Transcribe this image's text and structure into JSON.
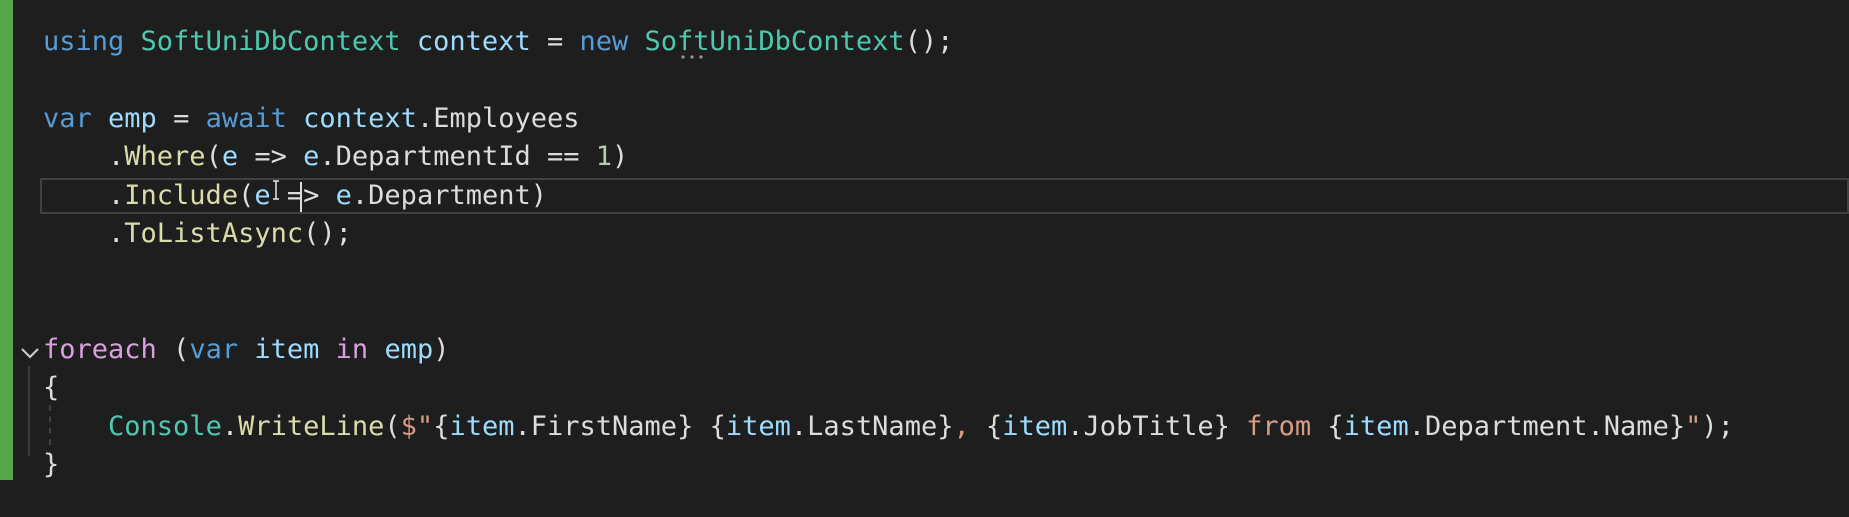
{
  "lines": [
    {
      "tokens": [
        {
          "t": "using",
          "c": "kw"
        },
        {
          "t": " "
        },
        {
          "t": "SoftUniDbContext",
          "c": "type"
        },
        {
          "t": " "
        },
        {
          "t": "context",
          "c": "local"
        },
        {
          "t": " = "
        },
        {
          "t": "new",
          "c": "kw"
        },
        {
          "t": " "
        },
        {
          "t": "SoftUniDbContext",
          "c": "type"
        },
        {
          "t": "();"
        }
      ]
    },
    {
      "tokens": []
    },
    {
      "tokens": [
        {
          "t": "var",
          "c": "kw"
        },
        {
          "t": " "
        },
        {
          "t": "emp",
          "c": "local"
        },
        {
          "t": " = "
        },
        {
          "t": "await",
          "c": "kw"
        },
        {
          "t": " "
        },
        {
          "t": "context",
          "c": "local"
        },
        {
          "t": "."
        },
        {
          "t": "Employees",
          "c": "prop"
        }
      ]
    },
    {
      "tokens": [
        {
          "t": "    ."
        },
        {
          "t": "Where",
          "c": "method"
        },
        {
          "t": "("
        },
        {
          "t": "e",
          "c": "local"
        },
        {
          "t": " => "
        },
        {
          "t": "e",
          "c": "local"
        },
        {
          "t": "."
        },
        {
          "t": "DepartmentId",
          "c": "prop"
        },
        {
          "t": " == "
        },
        {
          "t": "1",
          "c": "num"
        },
        {
          "t": ")"
        }
      ]
    },
    {
      "tokens": [
        {
          "t": "    ."
        },
        {
          "t": "Include",
          "c": "method"
        },
        {
          "t": "("
        },
        {
          "t": "e",
          "c": "local"
        },
        {
          "t": " => "
        },
        {
          "t": "e",
          "c": "local"
        },
        {
          "t": "."
        },
        {
          "t": "Department",
          "c": "prop"
        },
        {
          "t": ")"
        }
      ]
    },
    {
      "tokens": [
        {
          "t": "    ."
        },
        {
          "t": "ToListAsync",
          "c": "method"
        },
        {
          "t": "();"
        }
      ]
    },
    {
      "tokens": []
    },
    {
      "tokens": []
    },
    {
      "tokens": [
        {
          "t": "foreach",
          "c": "ctrl"
        },
        {
          "t": " ("
        },
        {
          "t": "var",
          "c": "kw"
        },
        {
          "t": " "
        },
        {
          "t": "item",
          "c": "local"
        },
        {
          "t": " "
        },
        {
          "t": "in",
          "c": "ctrl"
        },
        {
          "t": " "
        },
        {
          "t": "emp",
          "c": "local"
        },
        {
          "t": ")"
        }
      ]
    },
    {
      "tokens": [
        {
          "t": "{"
        }
      ]
    },
    {
      "tokens": [
        {
          "t": "    "
        },
        {
          "t": "Console",
          "c": "type"
        },
        {
          "t": "."
        },
        {
          "t": "WriteLine",
          "c": "method"
        },
        {
          "t": "("
        },
        {
          "t": "$\"",
          "c": "str"
        },
        {
          "t": "{"
        },
        {
          "t": "item",
          "c": "local"
        },
        {
          "t": "."
        },
        {
          "t": "FirstName",
          "c": "prop"
        },
        {
          "t": "}"
        },
        {
          "t": " ",
          "c": "str"
        },
        {
          "t": "{"
        },
        {
          "t": "item",
          "c": "local"
        },
        {
          "t": "."
        },
        {
          "t": "LastName",
          "c": "prop"
        },
        {
          "t": "}"
        },
        {
          "t": ", ",
          "c": "str"
        },
        {
          "t": "{"
        },
        {
          "t": "item",
          "c": "local"
        },
        {
          "t": "."
        },
        {
          "t": "JobTitle",
          "c": "prop"
        },
        {
          "t": "}"
        },
        {
          "t": " from ",
          "c": "str"
        },
        {
          "t": "{"
        },
        {
          "t": "item",
          "c": "local"
        },
        {
          "t": "."
        },
        {
          "t": "Department",
          "c": "prop"
        },
        {
          "t": "."
        },
        {
          "t": "Name",
          "c": "prop"
        },
        {
          "t": "}"
        },
        {
          "t": "\"",
          "c": "str"
        },
        {
          "t": ");"
        }
      ]
    },
    {
      "tokens": [
        {
          "t": "}"
        }
      ]
    }
  ],
  "colors": {
    "background": "#1e1e1e",
    "keyword": "#569cd6",
    "control": "#d8a0df",
    "type": "#4ec9b0",
    "local": "#9cdcfe",
    "method": "#dcdcaa",
    "number": "#b5cea8",
    "string": "#d69d85",
    "default": "#dcdcdc",
    "change_bar": "#57a64a"
  }
}
